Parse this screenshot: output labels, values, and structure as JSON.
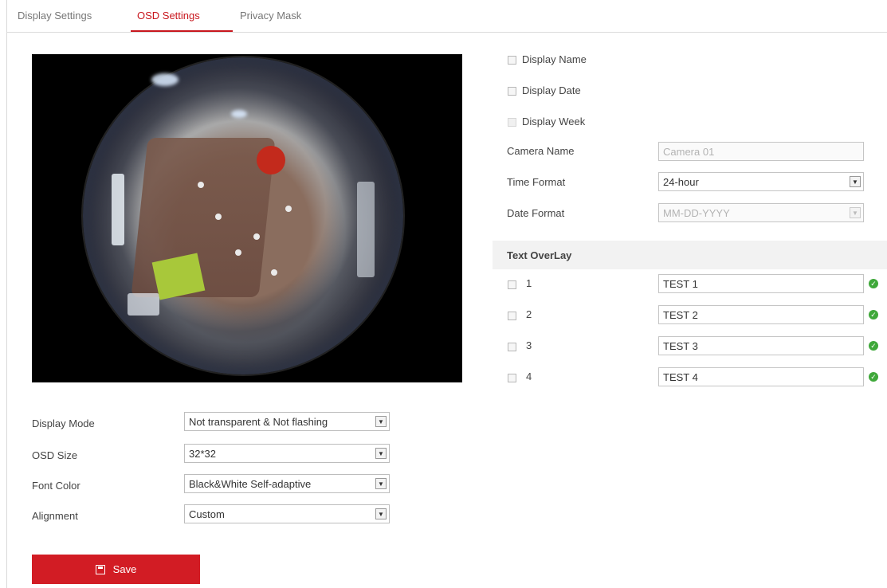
{
  "tabs": [
    {
      "label": "Display Settings",
      "active": false
    },
    {
      "label": "OSD Settings",
      "active": true
    },
    {
      "label": "Privacy Mask",
      "active": false
    }
  ],
  "accent_color": "#d21c24",
  "display_options": [
    {
      "label": "Display Name",
      "checked": false,
      "enabled": true
    },
    {
      "label": "Display Date",
      "checked": false,
      "enabled": true
    },
    {
      "label": "Display Week",
      "checked": false,
      "enabled": false
    }
  ],
  "camera_name": {
    "label": "Camera Name",
    "value": "Camera 01"
  },
  "time_format": {
    "label": "Time Format",
    "value": "24-hour"
  },
  "date_format": {
    "label": "Date Format",
    "value": "MM-DD-YYYY"
  },
  "text_overlay": {
    "title": "Text OverLay",
    "items": [
      {
        "index": "1",
        "value": "TEST 1",
        "checked": false
      },
      {
        "index": "2",
        "value": "TEST 2",
        "checked": false
      },
      {
        "index": "3",
        "value": "TEST 3",
        "checked": false
      },
      {
        "index": "4",
        "value": "TEST 4",
        "checked": false
      }
    ]
  },
  "osd_form": {
    "display_mode": {
      "label": "Display Mode",
      "value": "Not transparent & Not flashing"
    },
    "osd_size": {
      "label": "OSD Size",
      "value": "32*32"
    },
    "font_color": {
      "label": "Font Color",
      "value": "Black&White Self-adaptive"
    },
    "alignment": {
      "label": "Alignment",
      "value": "Custom"
    }
  },
  "save_label": "Save",
  "icons": {
    "dropdown": "chevron-down-icon",
    "valid": "check-circle-icon",
    "save": "floppy-disk-icon"
  }
}
